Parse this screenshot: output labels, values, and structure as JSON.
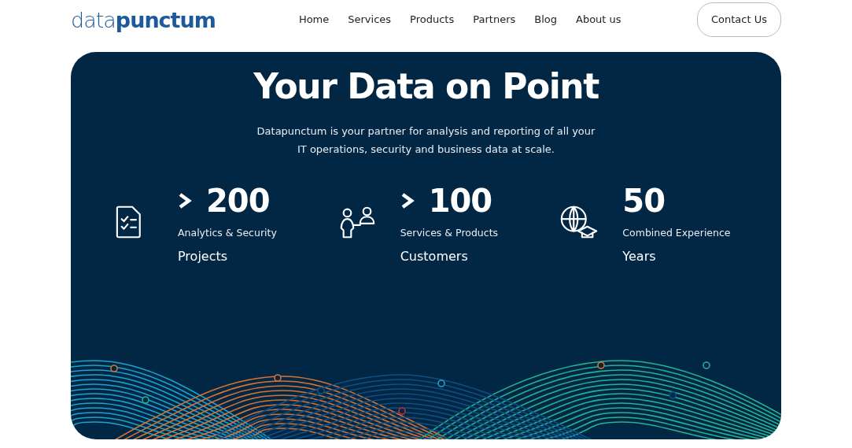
{
  "logo": "data**punctum**",
  "nav": [
    {
      "label": "Home"
    },
    {
      "label": "Services"
    },
    {
      "label": "Products"
    },
    {
      "label": "Partners"
    },
    {
      "label": "Blog"
    },
    {
      "label": "About us"
    }
  ],
  "contact_button": "Contact Us",
  "hero": {
    "title": "Your Data on Point",
    "subtitle": "Datapunctum is your partner for analysis and reporting of all your IT operations, security and business data at scale."
  },
  "stats": [
    {
      "kind": "checklist",
      "more_than": true,
      "value": "200",
      "label": "Analytics & Security",
      "unit": "Projects"
    },
    {
      "kind": "people",
      "more_than": true,
      "value": "100",
      "label": "Services & Products",
      "unit": "Customers"
    },
    {
      "kind": "globe",
      "more_than": false,
      "value": "50",
      "label": "Combined Experience",
      "unit": "Years"
    }
  ]
}
